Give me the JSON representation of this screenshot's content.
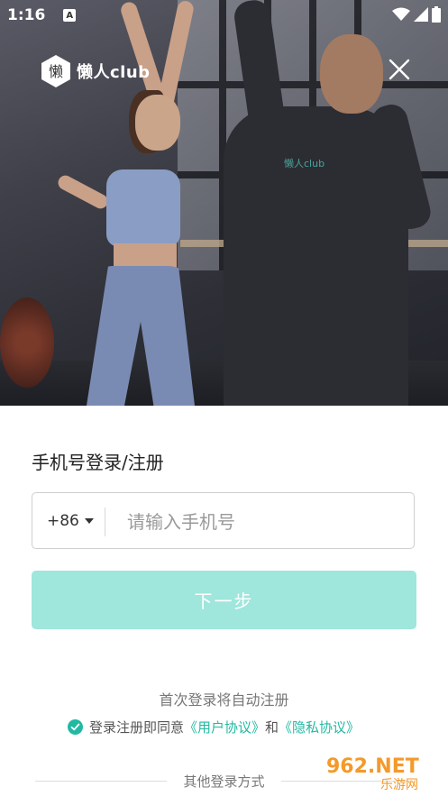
{
  "status_bar": {
    "time": "1:16",
    "notification_icon": "A"
  },
  "brand": {
    "name": "懒人club",
    "logo_char": "懒"
  },
  "form": {
    "title": "手机号登录/注册",
    "country_code": "+86",
    "phone_placeholder": "请输入手机号",
    "next_label": "下一步",
    "auto_register_hint": "首次登录将自动注册",
    "agree_prefix": "登录注册即同意",
    "user_agreement": "《用户协议》",
    "and": "和",
    "privacy_policy": "《隐私协议》",
    "other_login": "其他登录方式"
  },
  "watermark": {
    "site": "962.NET",
    "sub": "乐游网"
  },
  "colors": {
    "accent": "#22b9a3",
    "button_disabled": "#9fe6dc"
  }
}
